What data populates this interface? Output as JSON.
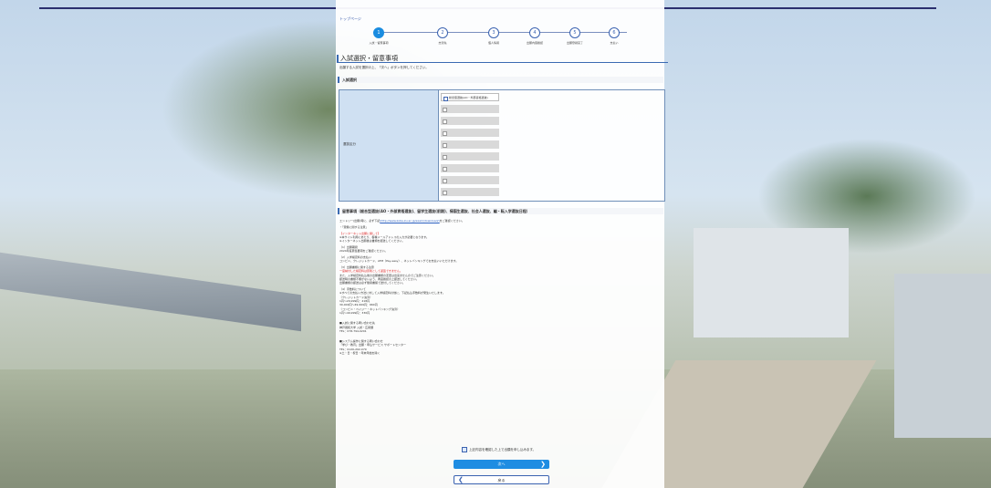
{
  "breadcrumb": "トップページ",
  "steps": [
    {
      "num": "1",
      "label": "入試・留意事項"
    },
    {
      "num": "2",
      "label": "志望先"
    },
    {
      "num": "3",
      "label": "個人情報"
    },
    {
      "num": "4",
      "label": "出願内容確認"
    },
    {
      "num": "5",
      "label": "出願登録完了"
    },
    {
      "num": "6",
      "label": "支払い"
    }
  ],
  "page": {
    "title": "入試選択・留意事項",
    "subtitle": "出願する入試を選択の上、「次へ」ボタンを押してください。"
  },
  "section1": {
    "heading": "入試選択",
    "row_label": "選抜区分",
    "options": [
      {
        "label": "総合型選抜(AO・外部資格選抜)",
        "selected": true
      },
      {
        "label": "",
        "selected": false
      },
      {
        "label": "",
        "selected": false
      },
      {
        "label": "",
        "selected": false
      },
      {
        "label": "",
        "selected": false
      },
      {
        "label": "",
        "selected": false
      },
      {
        "label": "",
        "selected": false
      },
      {
        "label": "",
        "selected": false
      },
      {
        "label": "",
        "selected": false
      }
    ]
  },
  "section2": {
    "heading": "留意事項（総合型選抜(AO・外部資格選抜)、留学生選抜(前期)、帰国生選抜、社会人選抜、編・転入学選抜日程）"
  },
  "notes": {
    "intro_prefix": "エントリー(出願)時に、必ず下記",
    "intro_link": "(http://www.kobe-ku.ac.jp/exam/download/)",
    "intro_suffix": "をご確認ください。",
    "bullet_head": "・「受験に関する注意」",
    "red_head": "【インターネット出願に関して】",
    "lines1": [
      "※本サイト利用にあたり、各種メールアドレスの入力が必要となります。",
      "※インターネット出願後は書類を郵送してください。"
    ],
    "p1": "（1）出願期間",
    "p1_line": "2024年度募集要項をご確認ください。",
    "p2": "（2）入学検定料の支払い",
    "p2_line": "コンビニ、クレジットカード、ATM（Pay-easy）、ネットバンキングでお支払いいただけます。",
    "p3": "（3）出願書類に関する注意",
    "p3_red": "一度納付した検定料は原則として返還できません。",
    "p3_lines": [
      "また、入学検定料払込後の出願書類の変更は出来ませんのでご注意ください。",
      "郵送時の書類不備がないよう、再度確認の上郵送してください。",
      "出願書類の郵送は必ず簡易書留で送付してください。"
    ],
    "p4": "（4）手数料について",
    "p4_lines": [
      "※すべての支払い方法に対して入学検定料の他に、下記払込手数料が発生いたします。",
      "〈クレジットカード決済〉",
      "1円〜29,999円：418円",
      "30,000円〜49,999円：660円",
      "〈コンビニ・ペイジー・ネットバンキング決済〉",
      "1円〜49,999円：330円"
    ],
    "contact1_head": "■入試に関する問い合わせ先",
    "contact1_lines": [
      "神戸親和大学 入試・広報課",
      "TEL：078-794-0201"
    ],
    "contact2_head": "■システム操作に関する問い合わせ",
    "contact2_lines": [
      "「学び・教育」出願・申込サービス サポートセンター",
      "TEL：0120-202-079",
      "※土・日・祝日・年末年始を除く"
    ]
  },
  "agree_label": "上記内容を確認した上で出願を申し込みます。",
  "buttons": {
    "next": "次へ",
    "back": "戻る"
  }
}
